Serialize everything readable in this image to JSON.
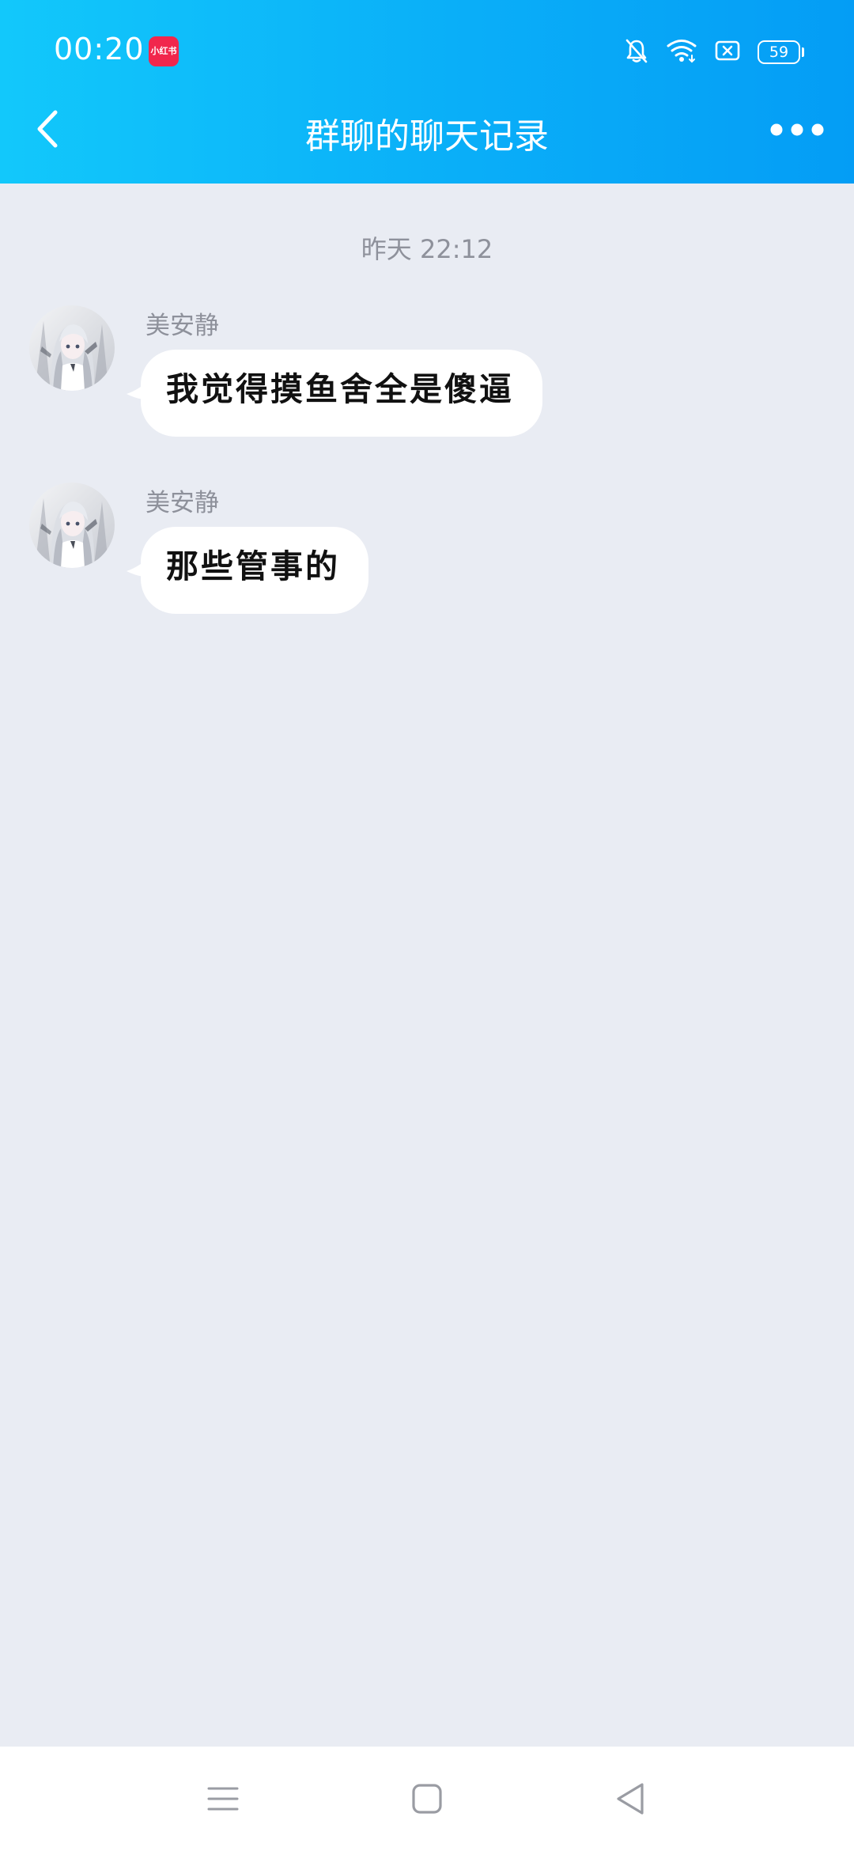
{
  "status_bar": {
    "time": "00:20",
    "app_badge": "小红书",
    "battery": "59",
    "icons": [
      "bell-off-icon",
      "wifi-icon",
      "sim-off-icon",
      "battery-icon"
    ]
  },
  "header": {
    "title": "群聊的聊天记录",
    "back_icon": "chevron-left-icon",
    "more_icon": "more-horizontal-icon",
    "background_colors": [
      "#12c8fb",
      "#049df5"
    ]
  },
  "chat": {
    "time_divider": "昨天 22:12",
    "messages": [
      {
        "sender": "美安静",
        "text": "我觉得摸鱼舍全是傻逼"
      },
      {
        "sender": "美安静",
        "text": "那些管事的"
      }
    ]
  },
  "nav_bar": {
    "icons": [
      "menu-icon",
      "home-square-icon",
      "back-triangle-icon"
    ]
  }
}
